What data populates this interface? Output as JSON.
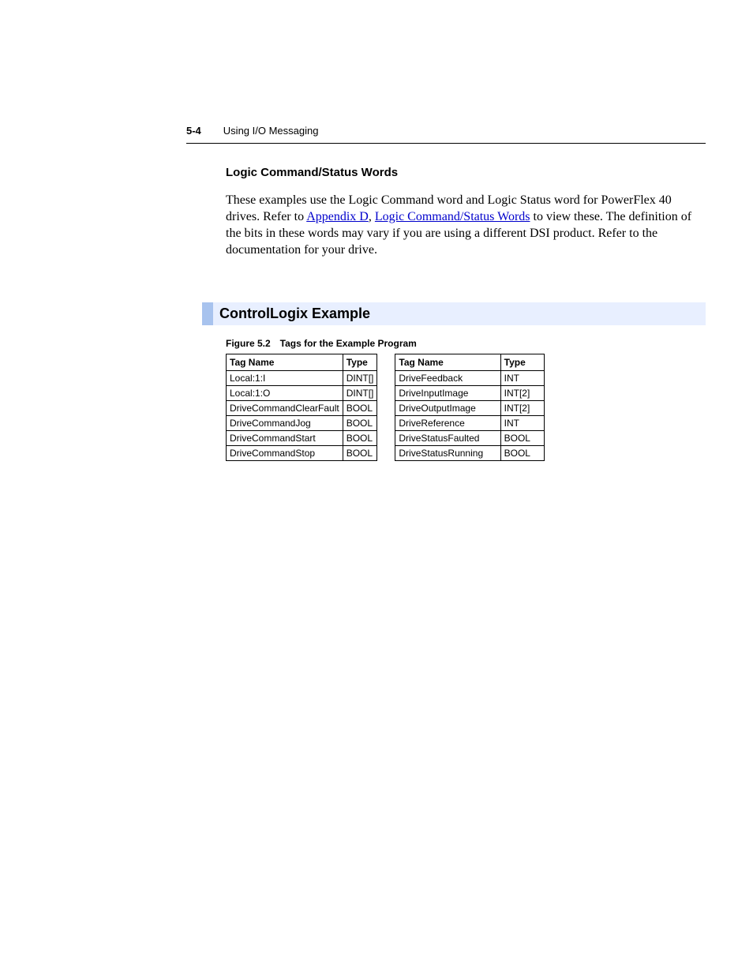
{
  "header": {
    "page_num": "5-4",
    "title": "Using I/O Messaging"
  },
  "section1": {
    "heading": "Logic Command/Status Words",
    "p_start": "These examples use the Logic Command word and Logic Status word for PowerFlex 40 drives. Refer to ",
    "link1": "Appendix D",
    "sep": ", ",
    "link2": "Logic Command/Status Words",
    "p_end": " to view these. The definition of the bits in these words may vary if you are using a different DSI product. Refer to the documentation for your drive."
  },
  "section2": {
    "title": "ControlLogix Example",
    "figure_caption": "Figure 5.2 Tags for the Example Program",
    "columns": {
      "name": "Tag Name",
      "type": "Type"
    },
    "table_left": [
      {
        "name": "Local:1:I",
        "type": "DINT[]"
      },
      {
        "name": "Local:1:O",
        "type": "DINT[]"
      },
      {
        "name": "DriveCommandClearFault",
        "type": "BOOL"
      },
      {
        "name": "DriveCommandJog",
        "type": "BOOL"
      },
      {
        "name": "DriveCommandStart",
        "type": "BOOL"
      },
      {
        "name": "DriveCommandStop",
        "type": "BOOL"
      }
    ],
    "table_right": [
      {
        "name": "DriveFeedback",
        "type": "INT"
      },
      {
        "name": "DriveInputImage",
        "type": "INT[2]"
      },
      {
        "name": "DriveOutputImage",
        "type": "INT[2]"
      },
      {
        "name": "DriveReference",
        "type": "INT"
      },
      {
        "name": "DriveStatusFaulted",
        "type": "BOOL"
      },
      {
        "name": "DriveStatusRunning",
        "type": "BOOL"
      }
    ]
  }
}
